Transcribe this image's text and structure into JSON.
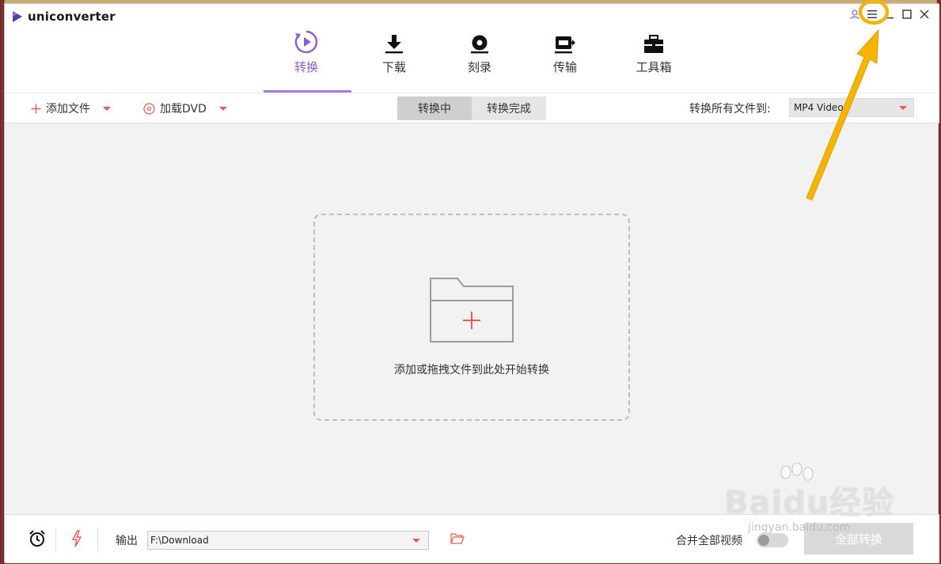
{
  "app": {
    "name": "uniconverter"
  },
  "nav": {
    "items": [
      {
        "label": "转换",
        "icon": "convert-icon",
        "active": true
      },
      {
        "label": "下载",
        "icon": "download-icon",
        "active": false
      },
      {
        "label": "刻录",
        "icon": "burn-disc-icon",
        "active": false
      },
      {
        "label": "传输",
        "icon": "transfer-icon",
        "active": false
      },
      {
        "label": "工具箱",
        "icon": "toolbox-icon",
        "active": false
      }
    ],
    "accent": "#8a5bd6"
  },
  "toolbar": {
    "add_file_label": "添加文件",
    "load_dvd_label": "加载DVD",
    "tabs": [
      {
        "label": "转换中",
        "active": true
      },
      {
        "label": "转换完成",
        "active": false
      }
    ],
    "target_label": "转换所有文件到:",
    "target_value": "MP4 Video"
  },
  "dropzone": {
    "text": "添加或拖拽文件到此处开始转换"
  },
  "bottom": {
    "output_label": "输出",
    "output_path": "F:\\Download",
    "merge_label": "合并全部视频",
    "convert_all_label": "全部转换"
  },
  "watermark": {
    "text": "Baidu经验",
    "sub": "jingyan.baidu.com"
  },
  "colors": {
    "brand_red": "#e85a4f",
    "highlight": "#f5b400"
  }
}
